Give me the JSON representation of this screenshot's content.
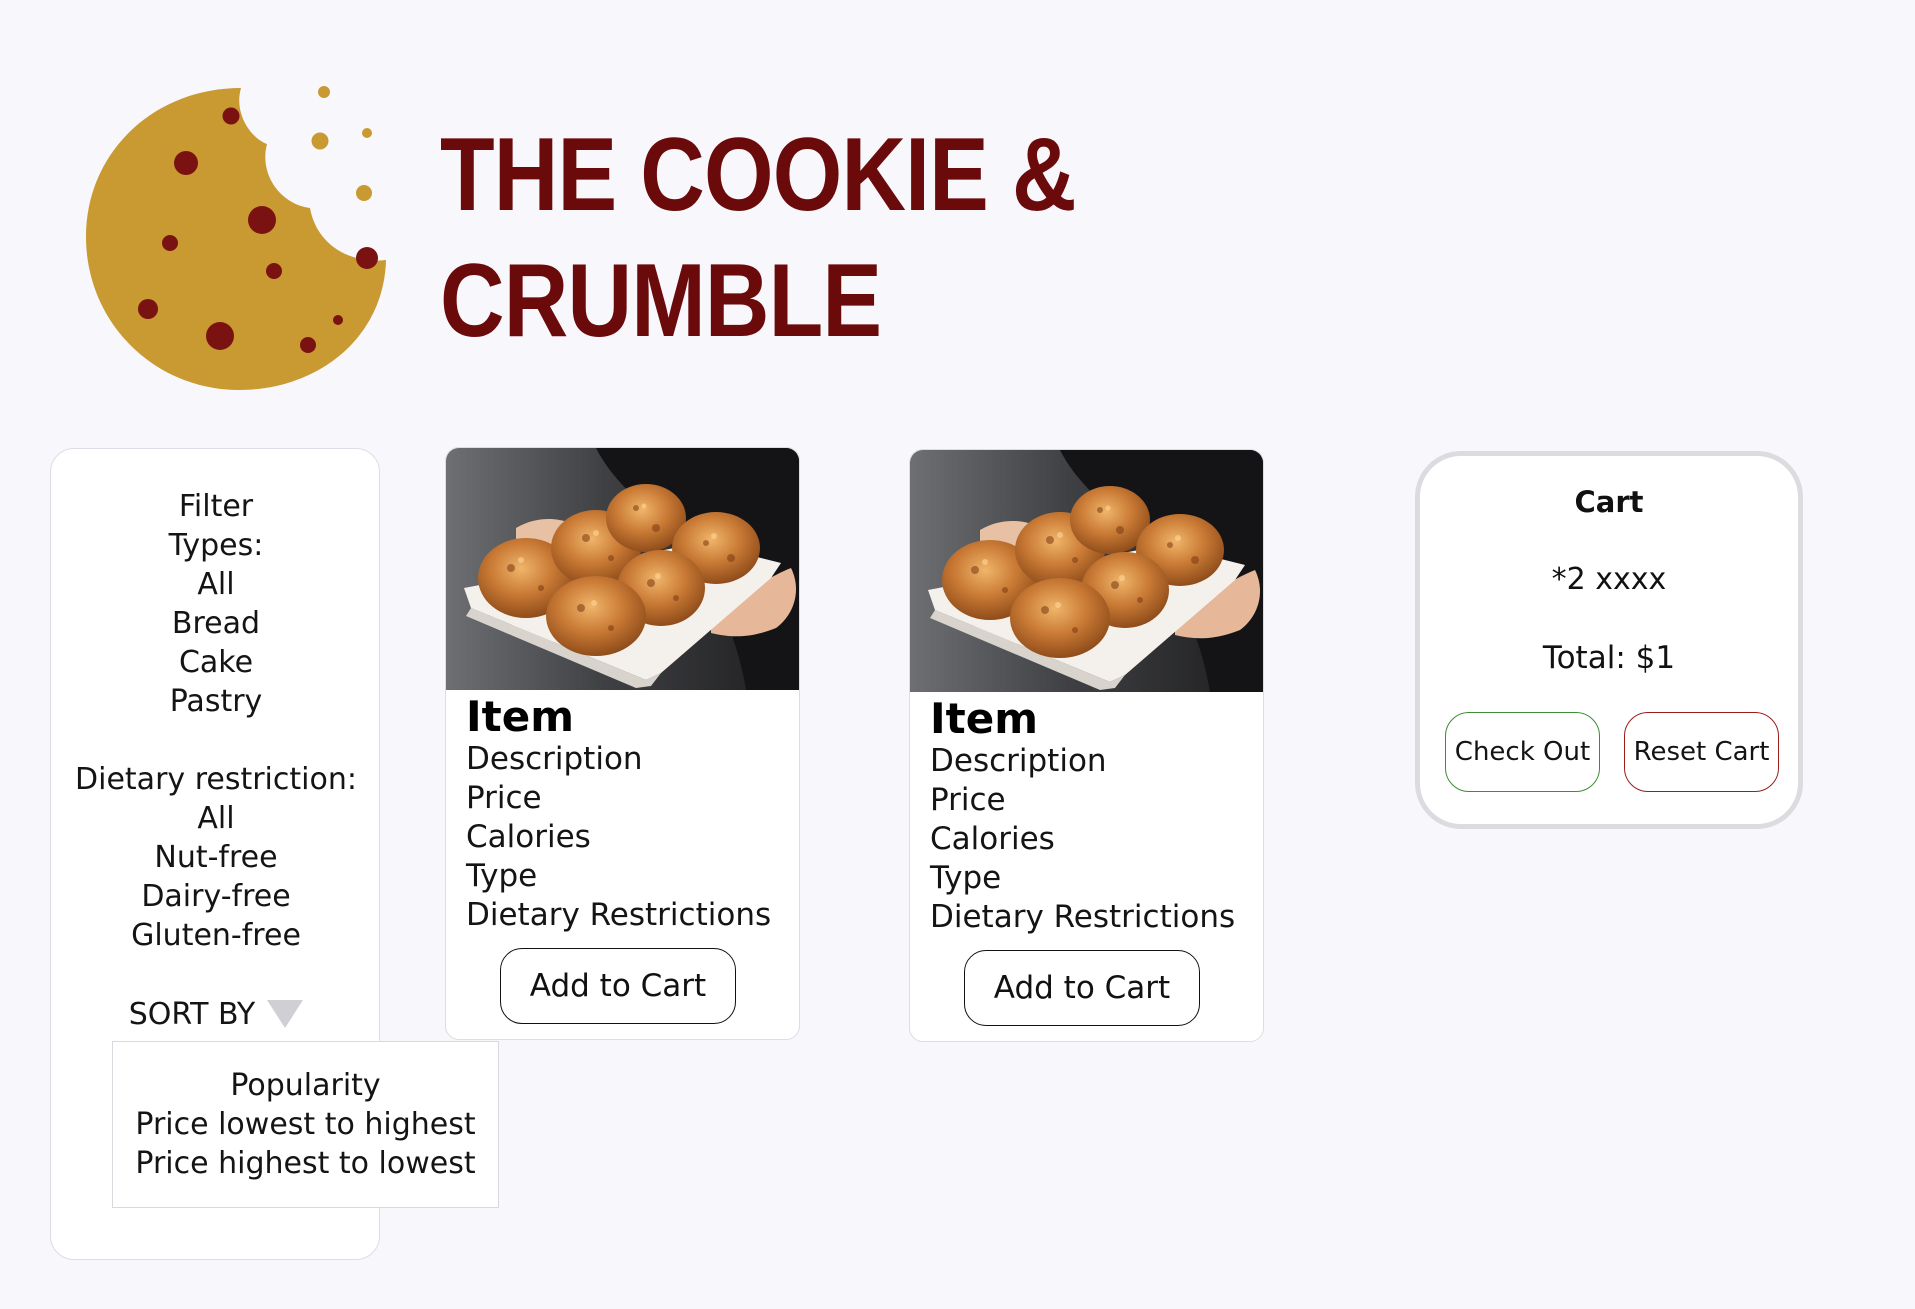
{
  "brand": {
    "name": "THE COOKIE & CRUMBLE",
    "logo_icon": "cookie-logo-icon",
    "colors": {
      "brand_red": "#6b0a0a",
      "cookie_gold": "#c99a32",
      "background": "#f7f7fc"
    }
  },
  "filters": {
    "heading": "Filter",
    "types_label": "Types:",
    "types": [
      "All",
      "Bread",
      "Cake",
      "Pastry"
    ],
    "dietary_label": "Dietary restriction:",
    "dietary": [
      "All",
      "Nut-free",
      "Dairy-free",
      "Gluten-free"
    ]
  },
  "sort": {
    "label": "SORT BY",
    "caret_icon": "caret-down-icon",
    "options": [
      "Popularity",
      "Price lowest to highest",
      "Price highest to lowest"
    ]
  },
  "products": [
    {
      "image": "coconut-macaroons-photo",
      "title": "Item",
      "description": "Description",
      "price": "Price",
      "calories": "Calories",
      "type": "Type",
      "dietary": "Dietary Restrictions",
      "button": "Add to Cart"
    },
    {
      "image": "coconut-macaroons-photo",
      "title": "Item",
      "description": "Description",
      "price": "Price",
      "calories": "Calories",
      "type": "Type",
      "dietary": "Dietary Restrictions",
      "button": "Add to Cart"
    }
  ],
  "cart": {
    "title": "Cart",
    "item_line": "*2 xxxx",
    "total": "Total: $1",
    "checkout_label": "Check Out",
    "checkout_color": "#3c8c34",
    "reset_label": "Reset Cart",
    "reset_color": "#9b1c1c"
  }
}
